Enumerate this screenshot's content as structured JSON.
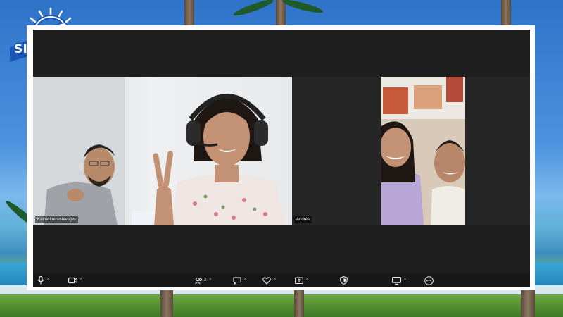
{
  "brand": {
    "logo_text": "SISTE VIAJES"
  },
  "participants": [
    {
      "name": "Katherine sisteviajes"
    },
    {
      "name": "Andrés"
    },
    {
      "name": ""
    },
    {
      "name": ""
    }
  ],
  "toolbar": {
    "mic": {
      "icon": "microphone-icon",
      "caret": "^"
    },
    "video": {
      "icon": "video-camera-icon",
      "caret": "^"
    },
    "participants": {
      "icon": "participants-icon",
      "count": "2",
      "caret": "^"
    },
    "chat": {
      "icon": "chat-bubble-icon",
      "caret": "^"
    },
    "reactions": {
      "icon": "heart-icon",
      "caret": "^"
    },
    "share": {
      "icon": "share-screen-icon",
      "caret": "^"
    },
    "security": {
      "icon": "shield-icon"
    },
    "view": {
      "icon": "monitor-icon",
      "caret": "^"
    },
    "more": {
      "icon": "more-options-icon"
    }
  },
  "colors": {
    "logo_blue": "#1a56b8",
    "meeting_bg": "#1f1f1f",
    "toolbar_bg": "#181818",
    "frame": "#ffffff"
  }
}
